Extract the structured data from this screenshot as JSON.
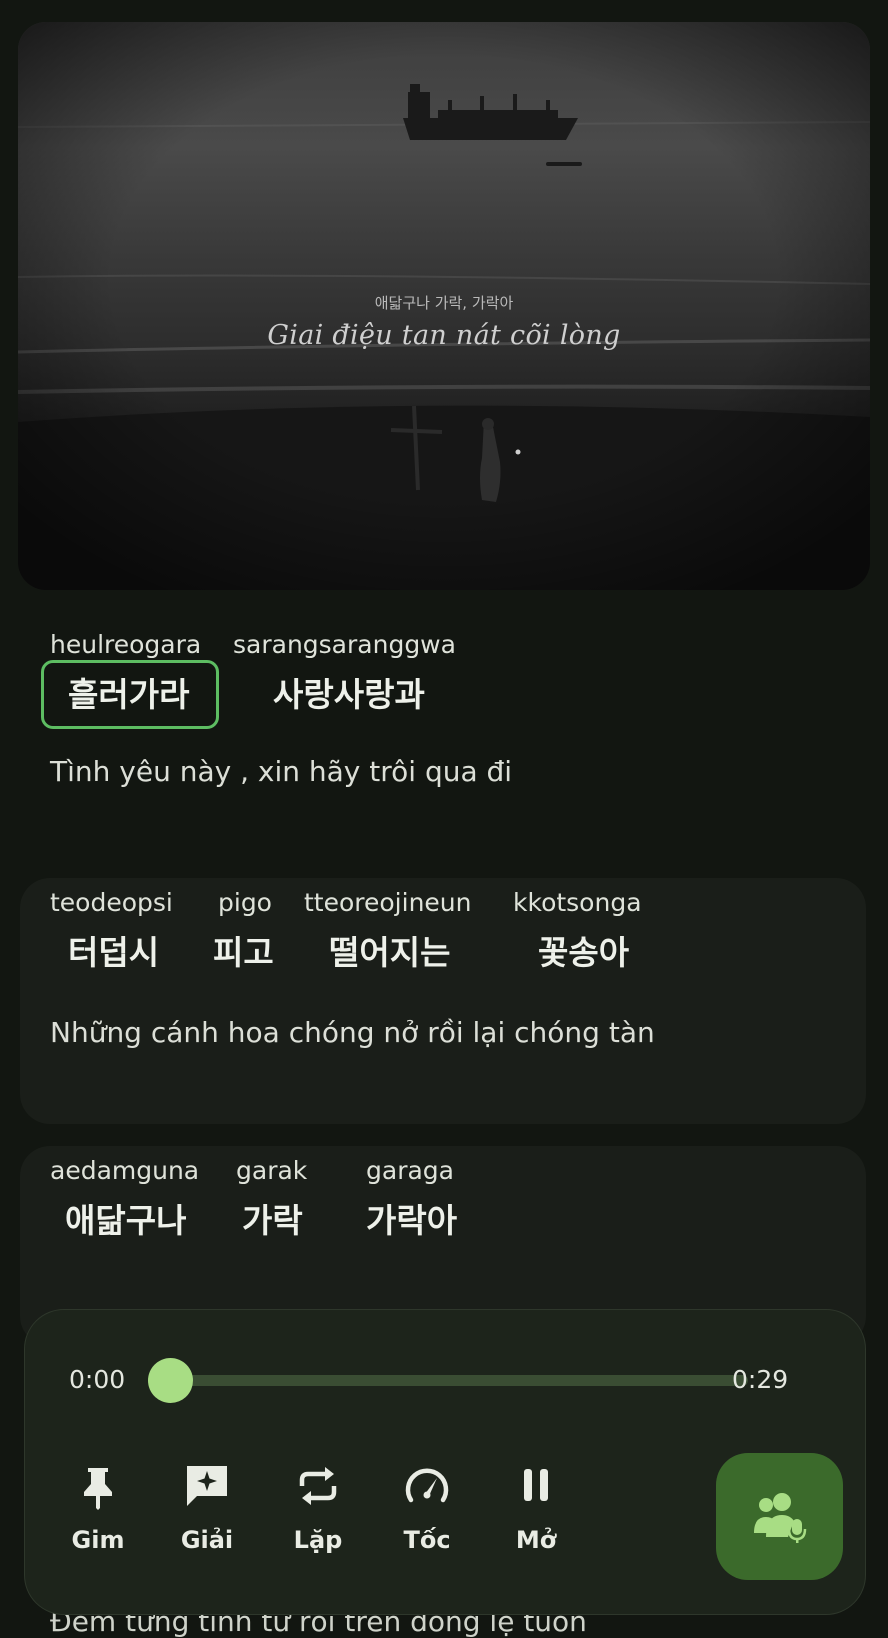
{
  "video": {
    "subtitle_korean": "애닯구나 가락, 가락아",
    "subtitle_vietnamese": "Giai điệu tan nát cõi lòng"
  },
  "lyrics": [
    {
      "words": [
        {
          "rom": "heulreogara",
          "ko": "흘러가라",
          "active": true
        },
        {
          "rom": "sarangsaranggwa",
          "ko": "사랑사랑과"
        }
      ],
      "translation": "Tình yêu này , xin hãy trôi qua đi"
    },
    {
      "words": [
        {
          "rom": "teodeopsi",
          "ko": "터덥시"
        },
        {
          "rom": "pigo",
          "ko": "피고"
        },
        {
          "rom": "tteoreojineun",
          "ko": "떨어지는"
        },
        {
          "rom": "kkotsonga",
          "ko": "꽃송아"
        }
      ],
      "translation": "Những cánh hoa chóng nở rồi lại chóng tàn"
    },
    {
      "words": [
        {
          "rom": "aedamguna",
          "ko": "애닮구나"
        },
        {
          "rom": "garak",
          "ko": "가락"
        },
        {
          "rom": "garaga",
          "ko": "가락아"
        }
      ],
      "translation": ""
    }
  ],
  "next_line_peek": "Đêm từng tình tư rồi trên dòng lệ tuôn",
  "player": {
    "current_time": "0:00",
    "total_time": "0:29",
    "progress": 0.0,
    "controls": [
      {
        "label": "Gim",
        "icon": "pin-icon"
      },
      {
        "label": "Giải",
        "icon": "sparkle-comment-icon"
      },
      {
        "label": "Lặp",
        "icon": "repeat-icon"
      },
      {
        "label": "Tốc",
        "icon": "speed-gauge-icon"
      },
      {
        "label": "Mở",
        "icon": "pause-icon"
      }
    ],
    "fab_icon": "karaoke-users-mic-icon"
  },
  "colors": {
    "background": "#121611",
    "accent": "#a8dd84",
    "highlight_border": "#5dbd62",
    "fab": "#3b6a2b"
  }
}
